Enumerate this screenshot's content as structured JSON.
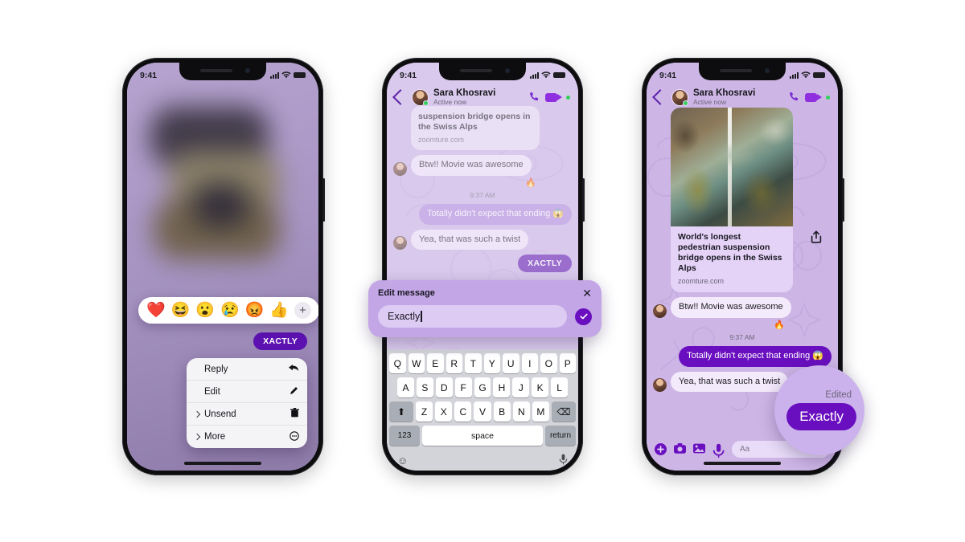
{
  "status_bar": {
    "time": "9:41",
    "signal_icon": "cellular-bars-icon",
    "wifi_icon": "wifi-icon",
    "battery_icon": "battery-icon"
  },
  "chat_header": {
    "back_icon": "back-chevron-icon",
    "name": "Sara Khosravi",
    "presence": "Active now",
    "avatar_name": "contact-avatar",
    "call_icon": "phone-call-icon",
    "video_icon": "video-call-icon"
  },
  "phone1": {
    "reaction_bar": {
      "reactions": [
        "❤️",
        "😆",
        "😮",
        "😢",
        "😡",
        "👍"
      ],
      "reaction_names": [
        "heart-reaction",
        "laugh-reaction",
        "wow-reaction",
        "sad-reaction",
        "angry-reaction",
        "thumbsup-reaction"
      ],
      "add_label": "+"
    },
    "selected_message": "XACTLY",
    "context_menu": [
      {
        "label": "Reply",
        "icon": "↩",
        "icon_name": "reply-arrow-icon",
        "has_chevron": false
      },
      {
        "label": "Edit",
        "icon": "✎",
        "icon_name": "pencil-icon",
        "has_chevron": false
      },
      {
        "label": "Unsend",
        "icon": "🗑",
        "icon_name": "trash-icon",
        "has_chevron": true
      },
      {
        "label": "More",
        "icon": "⊙",
        "icon_name": "more-circle-icon",
        "has_chevron": true
      }
    ]
  },
  "phone2": {
    "link_preview": {
      "title_line1": "suspension bridge opens in",
      "title_line2": "the Swiss Alps",
      "domain": "zoomture.com"
    },
    "messages": [
      {
        "from": "them",
        "text": "Btw!! Movie was awesome",
        "reaction": "🔥"
      },
      {
        "timestamp": "9:37 AM"
      },
      {
        "from": "me",
        "text": "Totally didn't expect that ending 😱"
      },
      {
        "from": "them",
        "text": "Yea, that was such a twist"
      },
      {
        "from": "me",
        "text": "XACTLY",
        "pill": true
      }
    ],
    "edit_sheet": {
      "title": "Edit message",
      "close_icon": "close-icon",
      "input_value": "Exactly",
      "confirm_icon": "checkmark-icon"
    },
    "keyboard": {
      "row1": [
        "Q",
        "W",
        "E",
        "R",
        "T",
        "Y",
        "U",
        "I",
        "O",
        "P"
      ],
      "row2": [
        "A",
        "S",
        "D",
        "F",
        "G",
        "H",
        "J",
        "K",
        "L"
      ],
      "row3": [
        "Z",
        "X",
        "C",
        "V",
        "B",
        "N",
        "M"
      ],
      "shift_icon": "⬆",
      "backspace_icon": "⌫",
      "numbers_key": "123",
      "space_key": "space",
      "return_key": "return",
      "emoji_icon": "☺",
      "mic_icon": "🎤"
    }
  },
  "phone3": {
    "link_preview": {
      "title": "World's longest pedestrian suspension bridge opens in the Swiss Alps",
      "domain": "zoomture.com",
      "share_icon": "share-icon",
      "image_name": "aerial-suspension-bridge-photo"
    },
    "messages": [
      {
        "from": "them",
        "text": "Btw!! Movie was awesome",
        "reaction": "🔥"
      },
      {
        "timestamp": "9:37 AM"
      },
      {
        "from": "me",
        "text": "Totally didn't expect that ending 😱"
      },
      {
        "from": "them",
        "text": "Yea, that was such a twist"
      }
    ],
    "magnifier": {
      "edited_label": "Edited",
      "message": "Exactly"
    },
    "composer": {
      "plus_icon": "plus-icon",
      "camera_icon": "camera-icon",
      "gallery_icon": "gallery-icon",
      "mic_icon": "microphone-icon",
      "placeholder": "Aa",
      "sticker_icon": "sticker-icon"
    }
  },
  "colors": {
    "page_bg": "#ffffff",
    "wallpaper": "#cdb6e6",
    "accent_purple": "#6a0fbf",
    "bubble_me": "#b18bdd",
    "bubble_them": "#f3eafb",
    "sheet_bg": "#c3a6e6"
  }
}
